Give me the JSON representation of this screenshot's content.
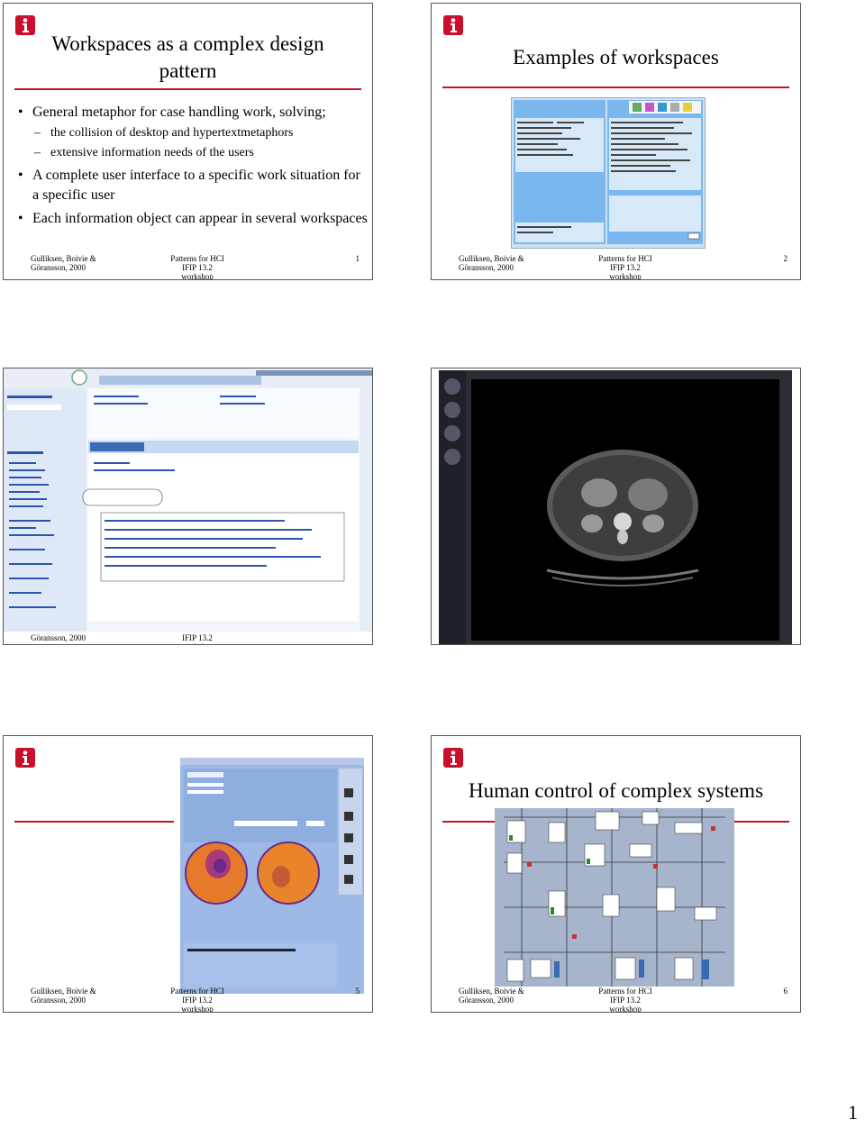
{
  "slides": [
    {
      "title": "Workspaces as a complex design pattern",
      "bullets": [
        {
          "text": "General metaphor for case handling work, solving;",
          "sub": [
            "the collision of desktop and hypertextmetaphors",
            "extensive information needs of the users"
          ]
        },
        {
          "text": "A complete user interface to a specific work situation for a specific user",
          "sub": []
        },
        {
          "text": "Each information object can appear in several workspaces",
          "sub": []
        }
      ],
      "footer": {
        "authors": "Gulliksen, Boivie & Göransson, 2000",
        "event": "Patterns for HCI IFIP 13.2 workshop",
        "number": "1"
      }
    },
    {
      "title": "Examples of workspaces",
      "footer": {
        "authors": "Gulliksen, Boivie & Göransson, 2000",
        "event": "Patterns for HCI IFIP 13.2 workshop",
        "number": "2"
      }
    },
    {
      "footer_partial": {
        "authors": "Göransson, 2000",
        "event": "IFIP 13.2 workshop"
      }
    },
    {},
    {
      "footer": {
        "authors": "Gulliksen, Boivie & Göransson, 2000",
        "event": "Patterns for HCI IFIP 13.2 workshop",
        "number": "5"
      }
    },
    {
      "title": "Human control of complex systems",
      "footer": {
        "authors": "Gulliksen, Boivie & Göransson, 2000",
        "event": "Patterns for HCI IFIP 13.2 workshop",
        "number": "6"
      }
    }
  ],
  "page_number": "1",
  "colors": {
    "accent": "#c8102e",
    "border": "#555555"
  }
}
